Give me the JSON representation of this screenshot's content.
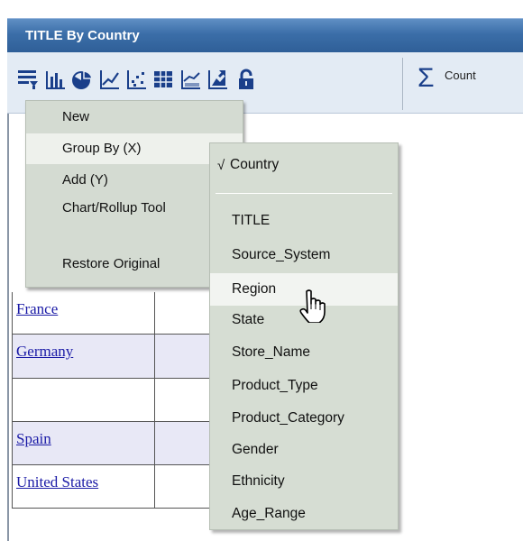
{
  "window": {
    "title": "TITLE By Country"
  },
  "toolbar": {
    "icons": [
      "filter-list-icon",
      "bar-chart-icon",
      "pie-chart-icon",
      "line-chart-icon",
      "scatter-chart-icon",
      "grid-table-icon",
      "area-chart-icon",
      "export-icon",
      "lock-icon"
    ],
    "count_label": "Count"
  },
  "table": {
    "rows": [
      {
        "label": "France"
      },
      {
        "label": "Germany"
      },
      {
        "label": ""
      },
      {
        "label": "Spain"
      },
      {
        "label": "United States"
      }
    ]
  },
  "context_menu": {
    "items": [
      "New",
      "Group By (X)",
      "Add (Y)",
      "Chart/Rollup Tool",
      "Restore Original"
    ]
  },
  "group_by_submenu": {
    "selected_check": "√",
    "selected": "Country",
    "items": [
      "TITLE",
      "Source_System",
      "Region",
      "State",
      "Store_Name",
      "Product_Type",
      "Product_Category",
      "Gender",
      "Ethnicity",
      "Age_Range"
    ],
    "hovered": "Region"
  }
}
